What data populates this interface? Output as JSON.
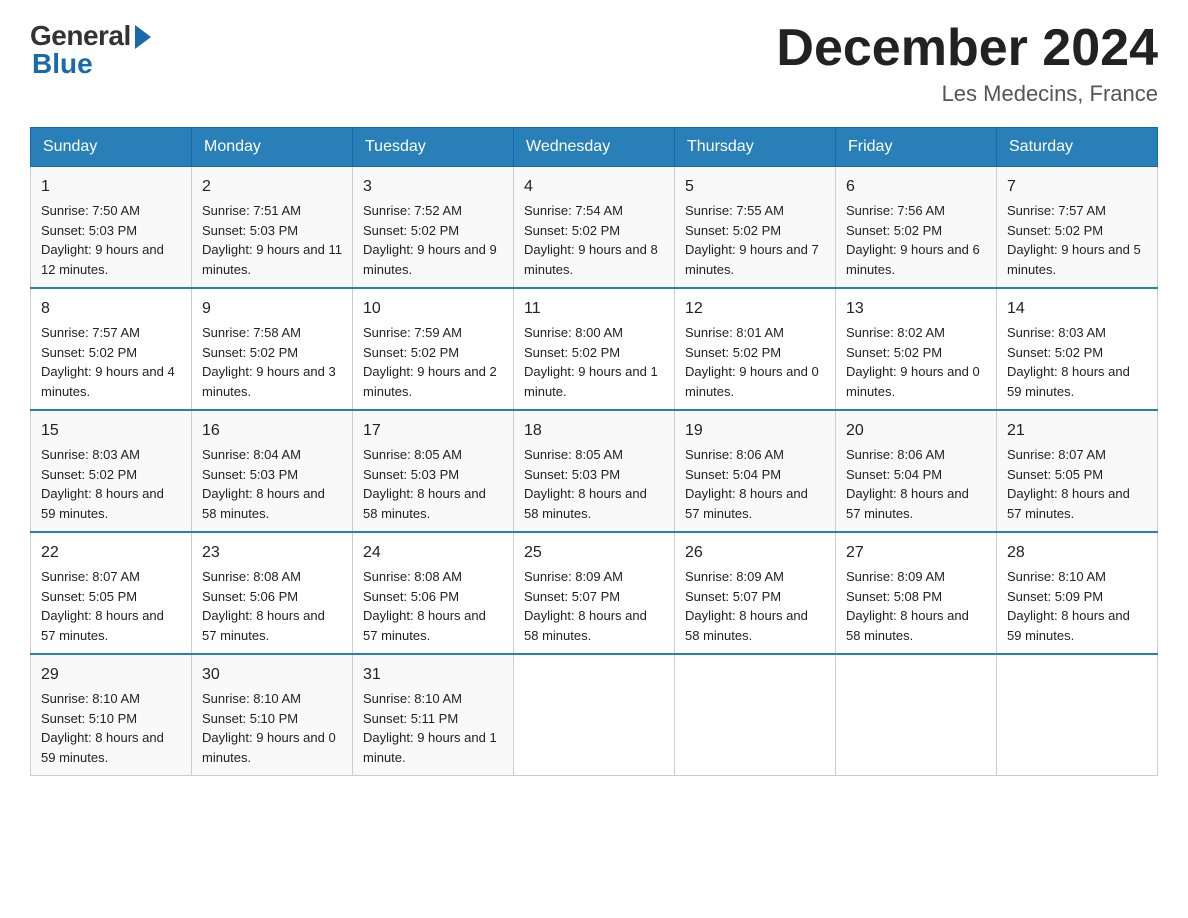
{
  "header": {
    "logo_general": "General",
    "logo_blue": "Blue",
    "month_title": "December 2024",
    "location": "Les Medecins, France"
  },
  "days_of_week": [
    "Sunday",
    "Monday",
    "Tuesday",
    "Wednesday",
    "Thursday",
    "Friday",
    "Saturday"
  ],
  "weeks": [
    [
      {
        "num": "1",
        "sunrise": "7:50 AM",
        "sunset": "5:03 PM",
        "daylight": "9 hours and 12 minutes."
      },
      {
        "num": "2",
        "sunrise": "7:51 AM",
        "sunset": "5:03 PM",
        "daylight": "9 hours and 11 minutes."
      },
      {
        "num": "3",
        "sunrise": "7:52 AM",
        "sunset": "5:02 PM",
        "daylight": "9 hours and 9 minutes."
      },
      {
        "num": "4",
        "sunrise": "7:54 AM",
        "sunset": "5:02 PM",
        "daylight": "9 hours and 8 minutes."
      },
      {
        "num": "5",
        "sunrise": "7:55 AM",
        "sunset": "5:02 PM",
        "daylight": "9 hours and 7 minutes."
      },
      {
        "num": "6",
        "sunrise": "7:56 AM",
        "sunset": "5:02 PM",
        "daylight": "9 hours and 6 minutes."
      },
      {
        "num": "7",
        "sunrise": "7:57 AM",
        "sunset": "5:02 PM",
        "daylight": "9 hours and 5 minutes."
      }
    ],
    [
      {
        "num": "8",
        "sunrise": "7:57 AM",
        "sunset": "5:02 PM",
        "daylight": "9 hours and 4 minutes."
      },
      {
        "num": "9",
        "sunrise": "7:58 AM",
        "sunset": "5:02 PM",
        "daylight": "9 hours and 3 minutes."
      },
      {
        "num": "10",
        "sunrise": "7:59 AM",
        "sunset": "5:02 PM",
        "daylight": "9 hours and 2 minutes."
      },
      {
        "num": "11",
        "sunrise": "8:00 AM",
        "sunset": "5:02 PM",
        "daylight": "9 hours and 1 minute."
      },
      {
        "num": "12",
        "sunrise": "8:01 AM",
        "sunset": "5:02 PM",
        "daylight": "9 hours and 0 minutes."
      },
      {
        "num": "13",
        "sunrise": "8:02 AM",
        "sunset": "5:02 PM",
        "daylight": "9 hours and 0 minutes."
      },
      {
        "num": "14",
        "sunrise": "8:03 AM",
        "sunset": "5:02 PM",
        "daylight": "8 hours and 59 minutes."
      }
    ],
    [
      {
        "num": "15",
        "sunrise": "8:03 AM",
        "sunset": "5:02 PM",
        "daylight": "8 hours and 59 minutes."
      },
      {
        "num": "16",
        "sunrise": "8:04 AM",
        "sunset": "5:03 PM",
        "daylight": "8 hours and 58 minutes."
      },
      {
        "num": "17",
        "sunrise": "8:05 AM",
        "sunset": "5:03 PM",
        "daylight": "8 hours and 58 minutes."
      },
      {
        "num": "18",
        "sunrise": "8:05 AM",
        "sunset": "5:03 PM",
        "daylight": "8 hours and 58 minutes."
      },
      {
        "num": "19",
        "sunrise": "8:06 AM",
        "sunset": "5:04 PM",
        "daylight": "8 hours and 57 minutes."
      },
      {
        "num": "20",
        "sunrise": "8:06 AM",
        "sunset": "5:04 PM",
        "daylight": "8 hours and 57 minutes."
      },
      {
        "num": "21",
        "sunrise": "8:07 AM",
        "sunset": "5:05 PM",
        "daylight": "8 hours and 57 minutes."
      }
    ],
    [
      {
        "num": "22",
        "sunrise": "8:07 AM",
        "sunset": "5:05 PM",
        "daylight": "8 hours and 57 minutes."
      },
      {
        "num": "23",
        "sunrise": "8:08 AM",
        "sunset": "5:06 PM",
        "daylight": "8 hours and 57 minutes."
      },
      {
        "num": "24",
        "sunrise": "8:08 AM",
        "sunset": "5:06 PM",
        "daylight": "8 hours and 57 minutes."
      },
      {
        "num": "25",
        "sunrise": "8:09 AM",
        "sunset": "5:07 PM",
        "daylight": "8 hours and 58 minutes."
      },
      {
        "num": "26",
        "sunrise": "8:09 AM",
        "sunset": "5:07 PM",
        "daylight": "8 hours and 58 minutes."
      },
      {
        "num": "27",
        "sunrise": "8:09 AM",
        "sunset": "5:08 PM",
        "daylight": "8 hours and 58 minutes."
      },
      {
        "num": "28",
        "sunrise": "8:10 AM",
        "sunset": "5:09 PM",
        "daylight": "8 hours and 59 minutes."
      }
    ],
    [
      {
        "num": "29",
        "sunrise": "8:10 AM",
        "sunset": "5:10 PM",
        "daylight": "8 hours and 59 minutes."
      },
      {
        "num": "30",
        "sunrise": "8:10 AM",
        "sunset": "5:10 PM",
        "daylight": "9 hours and 0 minutes."
      },
      {
        "num": "31",
        "sunrise": "8:10 AM",
        "sunset": "5:11 PM",
        "daylight": "9 hours and 1 minute."
      },
      null,
      null,
      null,
      null
    ]
  ]
}
